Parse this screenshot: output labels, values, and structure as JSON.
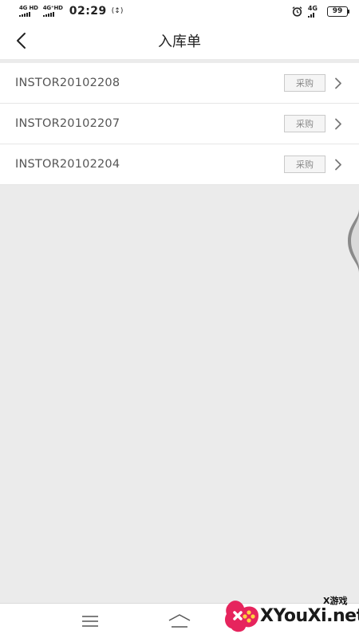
{
  "status_bar": {
    "sim1": "4G HD",
    "sim2": "4G⁺HD",
    "time": "02:29",
    "sync": "(↕)",
    "net": "4G",
    "battery": "99"
  },
  "header": {
    "title": "入库单"
  },
  "list": {
    "items": [
      {
        "code": "INSTOR20102208",
        "tag": "采购"
      },
      {
        "code": "INSTOR20102207",
        "tag": "采购"
      },
      {
        "code": "INSTOR20102204",
        "tag": "采购"
      }
    ]
  },
  "watermark": {
    "small": "X游戏",
    "text": "XYouXi.net"
  },
  "icons": {
    "back": "chevron-left-icon",
    "row_arrow": "chevron-right-icon",
    "nav_menu": "menu-icon",
    "nav_home": "home-icon",
    "alarm": "alarm-icon"
  },
  "colors": {
    "background": "#ebebeb",
    "surface": "#ffffff",
    "text_primary": "#222222",
    "text_secondary": "#555555",
    "tag_border": "#c9c9c9",
    "tag_text": "#8a8a8a",
    "watermark_accent": "#e6245d"
  }
}
